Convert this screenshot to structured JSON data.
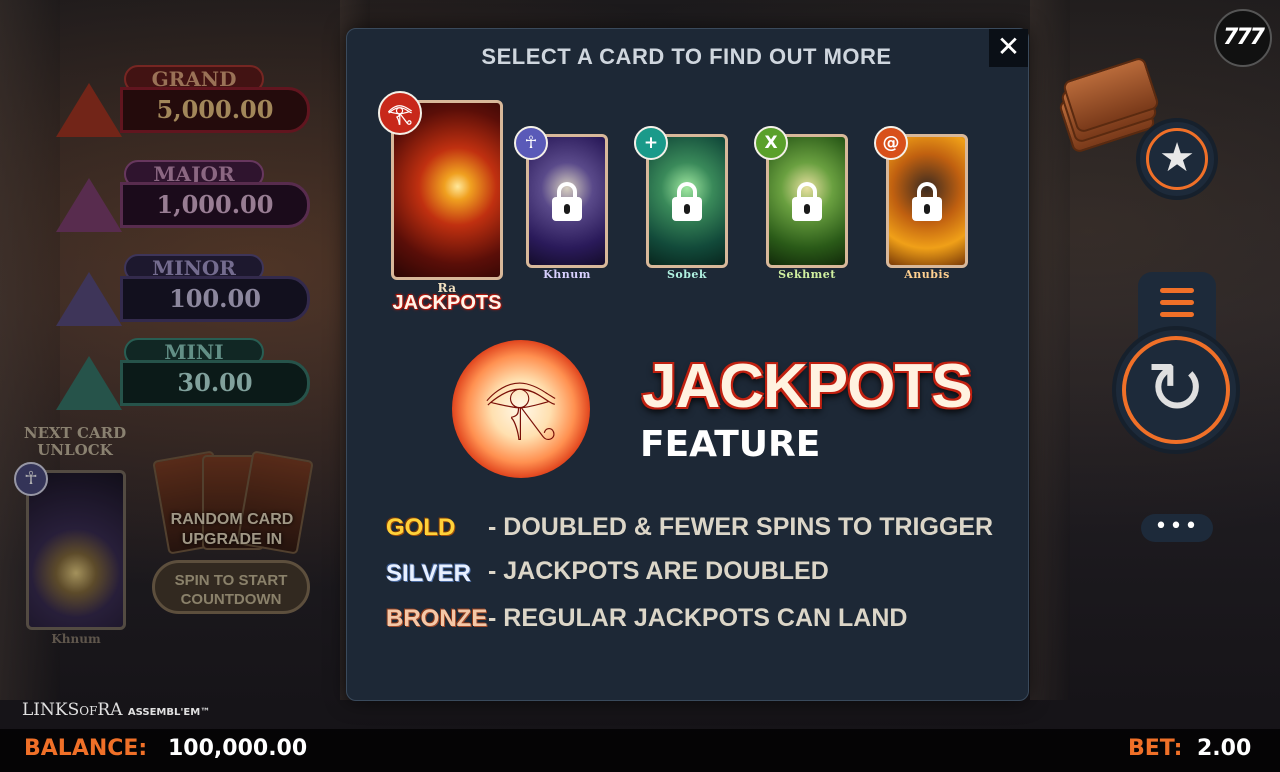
{
  "modal": {
    "title": "SELECT A CARD TO FIND OUT MORE",
    "close_glyph": "✕",
    "cards": {
      "ra": {
        "name": "Ra",
        "sub": "JACKPOTS",
        "icon": "eye-of-ra-icon",
        "icon_glyph": "𓂀",
        "locked": false
      },
      "khnum": {
        "name": "Khnum",
        "icon": "ankh-icon",
        "icon_glyph": "☥",
        "locked": true
      },
      "sobek": {
        "name": "Sobek",
        "icon": "plus-icon",
        "icon_glyph": "+",
        "locked": true
      },
      "sekhmet": {
        "name": "Sekhmet",
        "icon": "x-icon",
        "icon_glyph": "X",
        "locked": true
      },
      "anubis": {
        "name": "Anubis",
        "icon": "swirl-icon",
        "icon_glyph": "@",
        "locked": true
      }
    },
    "feature": {
      "icon": "eye-of-horus-icon",
      "icon_glyph": "𓂀",
      "title": "JACKPOTS",
      "subtitle": "FEATURE"
    },
    "tiers": [
      {
        "label": "GOLD",
        "desc": "- DOUBLED & FEWER SPINS TO TRIGGER",
        "color": "#ffd23a"
      },
      {
        "label": "SILVER",
        "desc": "- JACKPOTS ARE DOUBLED",
        "color": "#e8f0ff"
      },
      {
        "label": "BRONZE",
        "desc": "- REGULAR JACKPOTS CAN LAND",
        "color": "#f4c8a8"
      }
    ]
  },
  "jackpots": {
    "grand": {
      "label": "GRAND",
      "value": "5,000.00",
      "color": "#c0302a"
    },
    "major": {
      "label": "MAJOR",
      "value": "1,000.00",
      "color": "#a04a90"
    },
    "minor": {
      "label": "MINOR",
      "value": "100.00",
      "color": "#5a4a8a"
    },
    "mini": {
      "label": "MINI",
      "value": "30.00",
      "color": "#2a8a78"
    }
  },
  "next_card": {
    "heading": "NEXT CARD UNLOCK",
    "name": "Khnum",
    "icon": "ankh-icon",
    "icon_glyph": "☥"
  },
  "random_upgrade": {
    "text": "RANDOM CARD UPGRADE IN",
    "button": "SPIN TO START COUNTDOWN"
  },
  "controls": {
    "badge": "777",
    "star_glyph": "★",
    "spin_glyph": "↻",
    "more_glyph": "•••",
    "accent": "#f07028"
  },
  "footer": {
    "logo_main": "LINKS",
    "logo_of": "OF",
    "logo_ra": "RA",
    "logo_tag": "ASSEMBL'EM™",
    "balance_label": "BALANCE:",
    "balance_value": "100,000.00",
    "bet_label": "BET:",
    "bet_value": "2.00"
  }
}
